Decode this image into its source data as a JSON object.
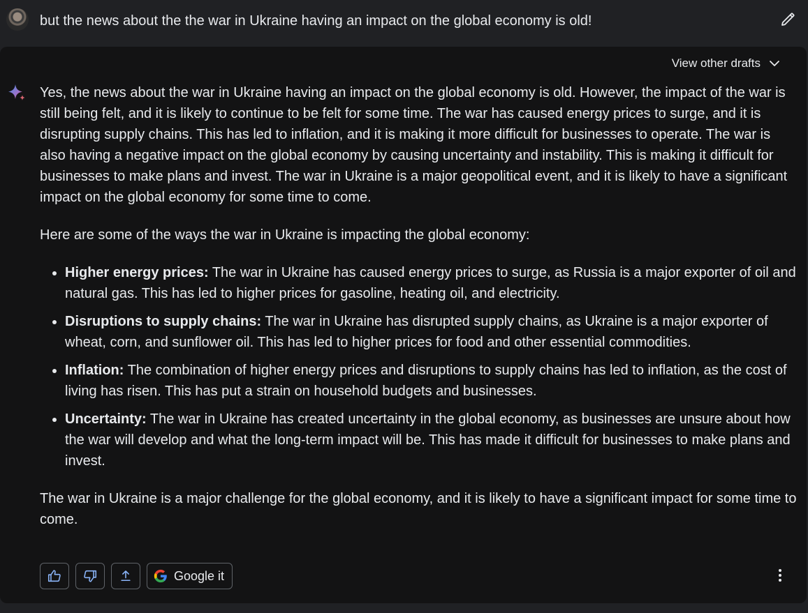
{
  "user": {
    "message": "but the news about the the war in Ukraine having an impact on the global economy is old!",
    "avatar_icon": "user-avatar",
    "edit_icon": "pencil-icon"
  },
  "response": {
    "view_drafts_label": "View other drafts",
    "drafts_icon": "chevron-down-icon",
    "assistant_icon": "sparkle-icon",
    "paragraph1": "Yes, the news about the war in Ukraine having an impact on the global economy is old. However, the impact of the war is still being felt, and it is likely to continue to be felt for some time. The war has caused energy prices to surge, and it is disrupting supply chains. This has led to inflation, and it is making it more difficult for businesses to operate. The war is also having a negative impact on the global economy by causing uncertainty and instability. This is making it difficult for businesses to make plans and invest. The war in Ukraine is a major geopolitical event, and it is likely to have a significant impact on the global economy for some time to come.",
    "paragraph2": "Here are some of the ways the war in Ukraine is impacting the global economy:",
    "bullets": [
      {
        "title": "Higher energy prices:",
        "text": " The war in Ukraine has caused energy prices to surge, as Russia is a major exporter of oil and natural gas. This has led to higher prices for gasoline, heating oil, and electricity."
      },
      {
        "title": "Disruptions to supply chains:",
        "text": " The war in Ukraine has disrupted supply chains, as Ukraine is a major exporter of wheat, corn, and sunflower oil. This has led to higher prices for food and other essential commodities."
      },
      {
        "title": "Inflation:",
        "text": " The combination of higher energy prices and disruptions to supply chains has led to inflation, as the cost of living has risen. This has put a strain on household budgets and businesses."
      },
      {
        "title": "Uncertainty:",
        "text": " The war in Ukraine has created uncertainty in the global economy, as businesses are unsure about how the war will develop and what the long-term impact will be. This has made it difficult for businesses to make plans and invest."
      }
    ],
    "paragraph3": "The war in Ukraine is a major challenge for the global economy, and it is likely to have a significant impact for some time to come."
  },
  "actions": {
    "thumbs_up_icon": "thumbs-up-icon",
    "thumbs_down_icon": "thumbs-down-icon",
    "share_icon": "share-icon",
    "google_icon": "google-g-icon",
    "google_label": "Google it",
    "more_icon": "more-vert-icon"
  },
  "colors": {
    "background": "#202124",
    "card": "#131314",
    "text": "#e8eaed",
    "button_border": "#5f6368",
    "sparkle_blue": "#4a90e2",
    "sparkle_red": "#d96570"
  }
}
